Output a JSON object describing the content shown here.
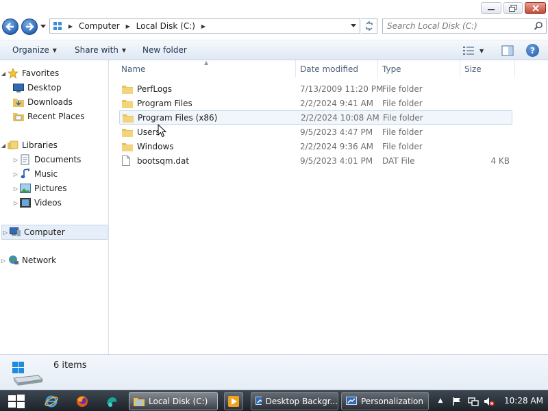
{
  "window": {
    "minimize_icon": "minimize-icon",
    "maximize_icon": "restore-icon",
    "close_icon": "close-icon",
    "close_color": "#c74a38"
  },
  "address": {
    "breadcrumbs": [
      "Computer",
      "Local Disk (C:)"
    ],
    "search_placeholder": "Search Local Disk (C:)"
  },
  "toolbar": {
    "organize": "Organize",
    "share_with": "Share with",
    "new_folder": "New folder"
  },
  "nav": {
    "favorites": "Favorites",
    "desktop": "Desktop",
    "downloads": "Downloads",
    "recent_places": "Recent Places",
    "libraries": "Libraries",
    "documents": "Documents",
    "music": "Music",
    "pictures": "Pictures",
    "videos": "Videos",
    "computer": "Computer",
    "network": "Network"
  },
  "columns": {
    "name": "Name",
    "date": "Date modified",
    "type": "Type",
    "size": "Size"
  },
  "files": [
    {
      "name": "PerfLogs",
      "date": "7/13/2009 11:20 PM",
      "type": "File folder",
      "size": "",
      "icon": "folder-icon"
    },
    {
      "name": "Program Files",
      "date": "2/2/2024 9:41 AM",
      "type": "File folder",
      "size": "",
      "icon": "folder-icon"
    },
    {
      "name": "Program Files (x86)",
      "date": "2/2/2024 10:08 AM",
      "type": "File folder",
      "size": "",
      "icon": "folder-icon"
    },
    {
      "name": "Users",
      "date": "9/5/2023 4:47 PM",
      "type": "File folder",
      "size": "",
      "icon": "folder-icon"
    },
    {
      "name": "Windows",
      "date": "2/2/2024 9:36 AM",
      "type": "File folder",
      "size": "",
      "icon": "folder-icon"
    },
    {
      "name": "bootsqm.dat",
      "date": "9/5/2023 4:01 PM",
      "type": "DAT File",
      "size": "4 KB",
      "icon": "file-icon"
    }
  ],
  "details": {
    "item_count": "6 items"
  },
  "taskbar": {
    "tasks": {
      "local_disk": "Local Disk (C:)",
      "desktop_background": "Desktop Backgr...",
      "personalization": "Personalization"
    },
    "clock": "10:28 AM"
  },
  "colors": {
    "accent": "#2a66b7",
    "folder": "#e8c25c",
    "taskbar": "#1c2228"
  }
}
